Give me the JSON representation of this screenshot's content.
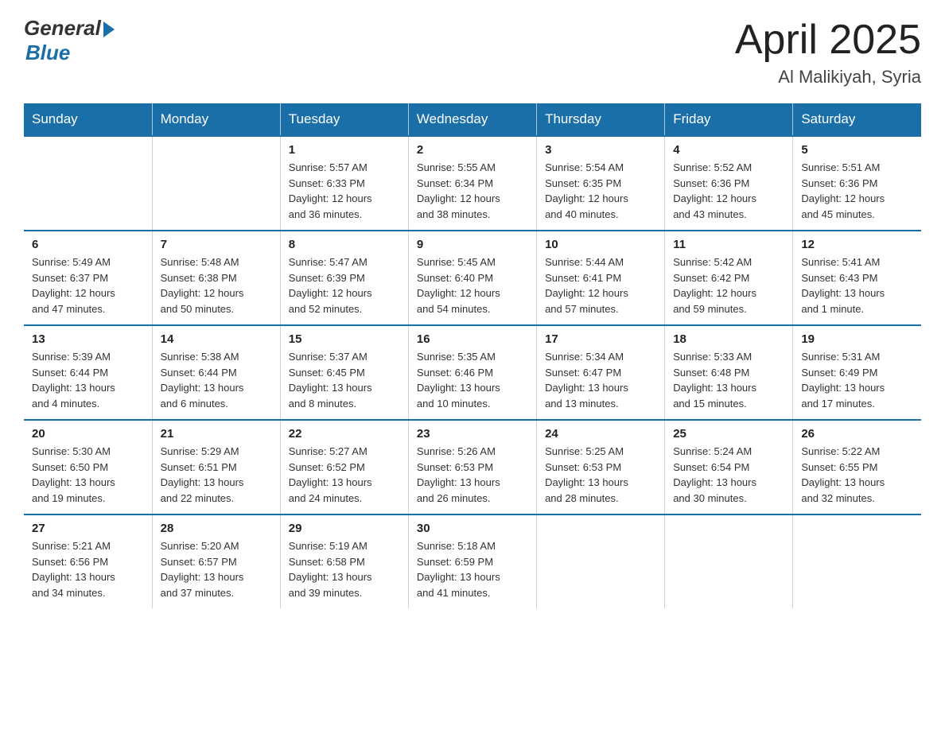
{
  "header": {
    "logo_general": "General",
    "logo_blue": "Blue",
    "title": "April 2025",
    "location": "Al Malikiyah, Syria"
  },
  "weekdays": [
    "Sunday",
    "Monday",
    "Tuesday",
    "Wednesday",
    "Thursday",
    "Friday",
    "Saturday"
  ],
  "weeks": [
    [
      {
        "day": "",
        "info": ""
      },
      {
        "day": "",
        "info": ""
      },
      {
        "day": "1",
        "info": "Sunrise: 5:57 AM\nSunset: 6:33 PM\nDaylight: 12 hours\nand 36 minutes."
      },
      {
        "day": "2",
        "info": "Sunrise: 5:55 AM\nSunset: 6:34 PM\nDaylight: 12 hours\nand 38 minutes."
      },
      {
        "day": "3",
        "info": "Sunrise: 5:54 AM\nSunset: 6:35 PM\nDaylight: 12 hours\nand 40 minutes."
      },
      {
        "day": "4",
        "info": "Sunrise: 5:52 AM\nSunset: 6:36 PM\nDaylight: 12 hours\nand 43 minutes."
      },
      {
        "day": "5",
        "info": "Sunrise: 5:51 AM\nSunset: 6:36 PM\nDaylight: 12 hours\nand 45 minutes."
      }
    ],
    [
      {
        "day": "6",
        "info": "Sunrise: 5:49 AM\nSunset: 6:37 PM\nDaylight: 12 hours\nand 47 minutes."
      },
      {
        "day": "7",
        "info": "Sunrise: 5:48 AM\nSunset: 6:38 PM\nDaylight: 12 hours\nand 50 minutes."
      },
      {
        "day": "8",
        "info": "Sunrise: 5:47 AM\nSunset: 6:39 PM\nDaylight: 12 hours\nand 52 minutes."
      },
      {
        "day": "9",
        "info": "Sunrise: 5:45 AM\nSunset: 6:40 PM\nDaylight: 12 hours\nand 54 minutes."
      },
      {
        "day": "10",
        "info": "Sunrise: 5:44 AM\nSunset: 6:41 PM\nDaylight: 12 hours\nand 57 minutes."
      },
      {
        "day": "11",
        "info": "Sunrise: 5:42 AM\nSunset: 6:42 PM\nDaylight: 12 hours\nand 59 minutes."
      },
      {
        "day": "12",
        "info": "Sunrise: 5:41 AM\nSunset: 6:43 PM\nDaylight: 13 hours\nand 1 minute."
      }
    ],
    [
      {
        "day": "13",
        "info": "Sunrise: 5:39 AM\nSunset: 6:44 PM\nDaylight: 13 hours\nand 4 minutes."
      },
      {
        "day": "14",
        "info": "Sunrise: 5:38 AM\nSunset: 6:44 PM\nDaylight: 13 hours\nand 6 minutes."
      },
      {
        "day": "15",
        "info": "Sunrise: 5:37 AM\nSunset: 6:45 PM\nDaylight: 13 hours\nand 8 minutes."
      },
      {
        "day": "16",
        "info": "Sunrise: 5:35 AM\nSunset: 6:46 PM\nDaylight: 13 hours\nand 10 minutes."
      },
      {
        "day": "17",
        "info": "Sunrise: 5:34 AM\nSunset: 6:47 PM\nDaylight: 13 hours\nand 13 minutes."
      },
      {
        "day": "18",
        "info": "Sunrise: 5:33 AM\nSunset: 6:48 PM\nDaylight: 13 hours\nand 15 minutes."
      },
      {
        "day": "19",
        "info": "Sunrise: 5:31 AM\nSunset: 6:49 PM\nDaylight: 13 hours\nand 17 minutes."
      }
    ],
    [
      {
        "day": "20",
        "info": "Sunrise: 5:30 AM\nSunset: 6:50 PM\nDaylight: 13 hours\nand 19 minutes."
      },
      {
        "day": "21",
        "info": "Sunrise: 5:29 AM\nSunset: 6:51 PM\nDaylight: 13 hours\nand 22 minutes."
      },
      {
        "day": "22",
        "info": "Sunrise: 5:27 AM\nSunset: 6:52 PM\nDaylight: 13 hours\nand 24 minutes."
      },
      {
        "day": "23",
        "info": "Sunrise: 5:26 AM\nSunset: 6:53 PM\nDaylight: 13 hours\nand 26 minutes."
      },
      {
        "day": "24",
        "info": "Sunrise: 5:25 AM\nSunset: 6:53 PM\nDaylight: 13 hours\nand 28 minutes."
      },
      {
        "day": "25",
        "info": "Sunrise: 5:24 AM\nSunset: 6:54 PM\nDaylight: 13 hours\nand 30 minutes."
      },
      {
        "day": "26",
        "info": "Sunrise: 5:22 AM\nSunset: 6:55 PM\nDaylight: 13 hours\nand 32 minutes."
      }
    ],
    [
      {
        "day": "27",
        "info": "Sunrise: 5:21 AM\nSunset: 6:56 PM\nDaylight: 13 hours\nand 34 minutes."
      },
      {
        "day": "28",
        "info": "Sunrise: 5:20 AM\nSunset: 6:57 PM\nDaylight: 13 hours\nand 37 minutes."
      },
      {
        "day": "29",
        "info": "Sunrise: 5:19 AM\nSunset: 6:58 PM\nDaylight: 13 hours\nand 39 minutes."
      },
      {
        "day": "30",
        "info": "Sunrise: 5:18 AM\nSunset: 6:59 PM\nDaylight: 13 hours\nand 41 minutes."
      },
      {
        "day": "",
        "info": ""
      },
      {
        "day": "",
        "info": ""
      },
      {
        "day": "",
        "info": ""
      }
    ]
  ]
}
